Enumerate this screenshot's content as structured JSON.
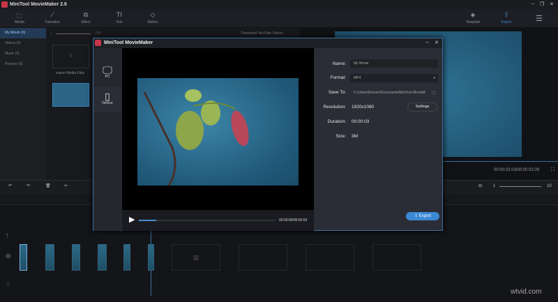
{
  "app": {
    "title": "MiniTool MovieMaker 2.6"
  },
  "toolbar": {
    "items": [
      {
        "label": "Media",
        "icon": "folder-icon"
      },
      {
        "label": "Transition",
        "icon": "transition-icon"
      },
      {
        "label": "Effect",
        "icon": "effect-icon"
      },
      {
        "label": "Text",
        "icon": "text-icon"
      },
      {
        "label": "Motion",
        "icon": "motion-icon"
      }
    ],
    "template": "Template",
    "export": "Export"
  },
  "sidebar": {
    "items": [
      {
        "label": "My Album  (6)"
      },
      {
        "label": "Videos  (0)"
      },
      {
        "label": "Music  (0)"
      },
      {
        "label": "Pictures  (6)"
      }
    ]
  },
  "media": {
    "zoom_min": "1",
    "zoom_max": "100",
    "download": "Download YouTube Videos",
    "import": "Import Media Files"
  },
  "preview": {
    "time": "00:00:03.03/00:00:03.09"
  },
  "timeline": {
    "zoom_min": "1",
    "zoom_max": "10"
  },
  "dialog": {
    "title": "MiniTool MovieMaker",
    "tabs": [
      {
        "label": "PC"
      },
      {
        "label": "Device"
      }
    ],
    "player_time": "00:00:00/00:00:03",
    "progress": 0.13,
    "labels": {
      "name": "Name:",
      "format": "Format:",
      "save_to": "Save To:",
      "resolution": "Resolution:",
      "duration": "Duration:",
      "size": "Size:"
    },
    "values": {
      "name": "My Movie",
      "format": "MP4",
      "save_to": "C:\\Users\\Doreen\\Documents\\MiniTool MovieM",
      "resolution": "1920x1080",
      "duration": "00:00:03",
      "size": "3M"
    },
    "settings": "Settings",
    "export": "Export"
  },
  "watermark": "wtvid.com"
}
